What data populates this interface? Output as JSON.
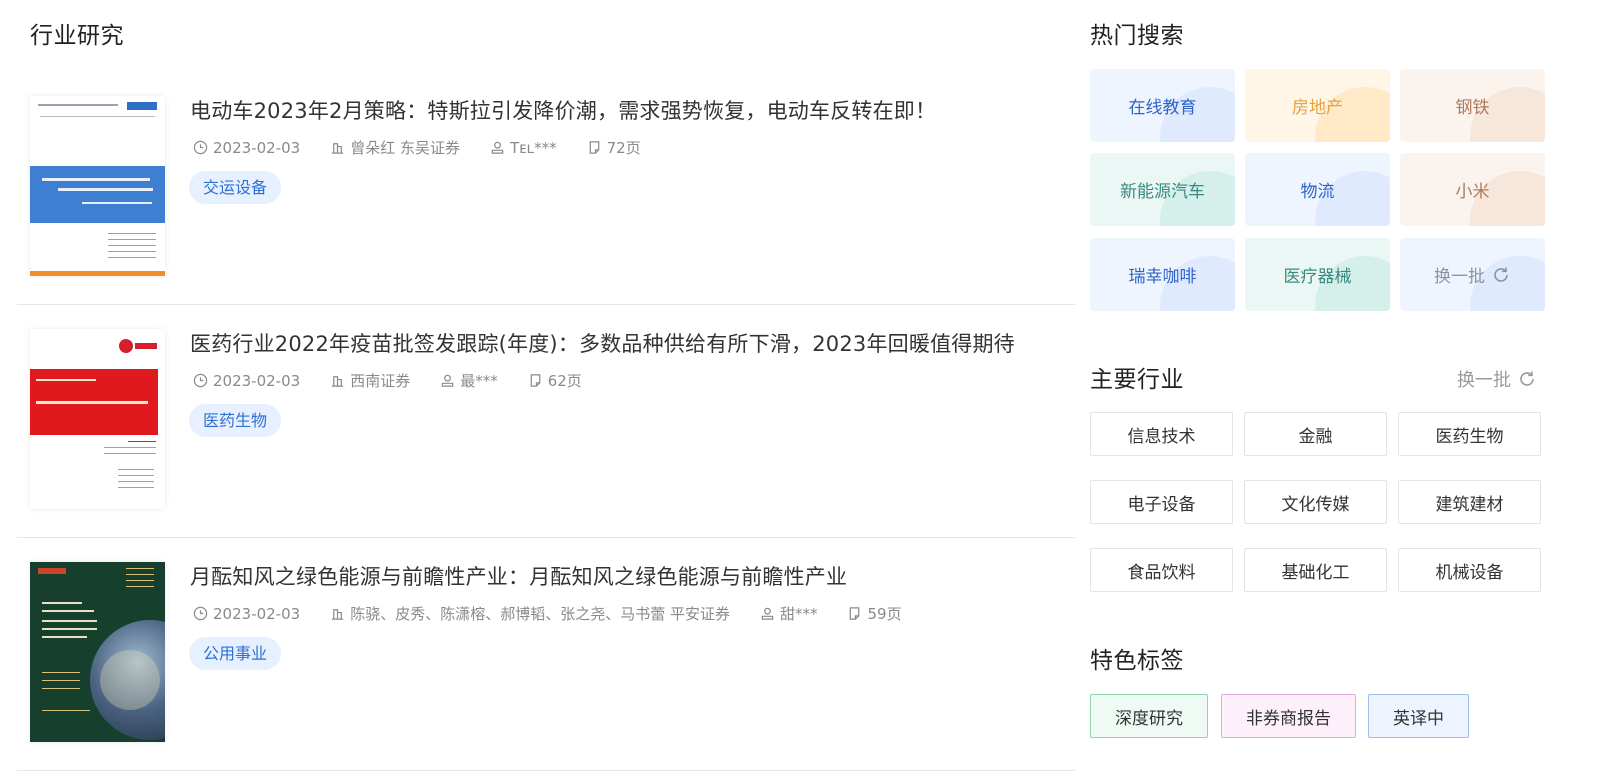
{
  "section_title": "行业研究",
  "reports": [
    {
      "title": "电动车2023年2月策略：特斯拉引发降价潮，需求强势恢复，电动车反转在即！",
      "date": "2023-02-03",
      "authors": "曾朵红  东吴证券",
      "uploader": "Tᴇʟ***",
      "pages": "72页",
      "tag": "交运设备",
      "thumb_text": "特斯拉引发降价潮，需求强势恢复，电动车反转在即！"
    },
    {
      "title": "医药行业2022年疫苗批签发跟踪(年度)：多数品种供给有所下滑，2023年回暖值得期待",
      "date": "2023-02-03",
      "authors": " 西南证券",
      "uploader": "最***",
      "pages": "62页",
      "tag": "医药生物",
      "thumb_text": "多数品种供给有所下滑，2023年回暖值得期待"
    },
    {
      "title": "月酝知风之绿色能源与前瞻性产业：月酝知风之绿色能源与前瞻性产业",
      "date": "2023-02-03",
      "authors": "陈骁、皮秀、陈潇榕、郝博韬、张之尧、马书蕾  平安证券",
      "uploader": "甜***",
      "pages": "59页",
      "tag": "公用事业",
      "thumb_text": "月酝知风之绿色能源与前瞻性产业"
    }
  ],
  "hot_search": {
    "title": "热门搜索",
    "items": [
      {
        "label": "在线教育",
        "color": "#2f63c7",
        "bg": "#eef5ff",
        "deco": "#dfeaff"
      },
      {
        "label": "房地产",
        "color": "#e6a23c",
        "bg": "#fff6e8",
        "deco": "#ffe9c6"
      },
      {
        "label": "钢铁",
        "color": "#b07a5e",
        "bg": "#fbf3ee",
        "deco": "#f7e6da"
      },
      {
        "label": "新能源汽车",
        "color": "#3a8a80",
        "bg": "#eaf7f5",
        "deco": "#d5efeb"
      },
      {
        "label": "物流",
        "color": "#2f63c7",
        "bg": "#eef5ff",
        "deco": "#dfeaff"
      },
      {
        "label": "小米",
        "color": "#b07a5e",
        "bg": "#fbf3ee",
        "deco": "#f7e6da"
      },
      {
        "label": "瑞幸咖啡",
        "color": "#2f63c7",
        "bg": "#eef5ff",
        "deco": "#dfeaff"
      },
      {
        "label": "医疗器械",
        "color": "#3a8a80",
        "bg": "#eaf7f5",
        "deco": "#d5efeb"
      },
      {
        "label": "换一批",
        "color": "#8a93a3",
        "bg": "#eef5ff",
        "deco": "#dfeaff"
      }
    ]
  },
  "main_industry": {
    "title": "主要行业",
    "refresh_label": "换一批",
    "items": [
      "信息技术",
      "金融",
      "医药生物",
      "电子设备",
      "文化传媒",
      "建筑建材",
      "食品饮料",
      "基础化工",
      "机械设备"
    ]
  },
  "feature_tags": {
    "title": "特色标签",
    "items": [
      {
        "label": "深度研究",
        "bg": "#eefaf3",
        "border": "#8fd8ad"
      },
      {
        "label": "非券商报告",
        "bg": "#fdf0fb",
        "border": "#e9a7e0"
      },
      {
        "label": "英译中",
        "bg": "#edf4ff",
        "border": "#9fc0ee"
      }
    ]
  },
  "icons": {
    "date": "clock-icon",
    "author": "building-icon",
    "uploader": "user-icon",
    "pages": "document-icon",
    "refresh": "refresh-icon"
  }
}
